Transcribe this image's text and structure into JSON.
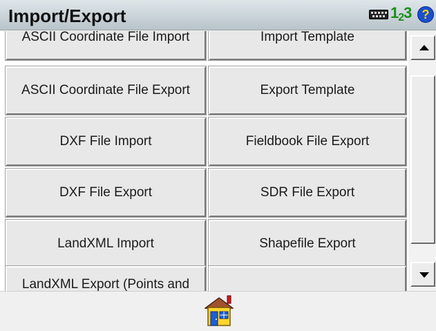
{
  "window": {
    "title": "Import/Export"
  },
  "status_icons": {
    "keyboard": "keyboard-icon",
    "numeric": "123",
    "help": "?"
  },
  "buttons": [
    "ASCII Coordinate File Import",
    "Import Template",
    "ASCII Coordinate File Export",
    "Export Template",
    "DXF File Import",
    "Fieldbook File Export",
    "DXF File Export",
    "SDR File Export",
    "LandXML Import",
    "Shapefile Export",
    "LandXML Export (Points and",
    ""
  ],
  "bottom": {
    "home_icon": "home-icon"
  }
}
